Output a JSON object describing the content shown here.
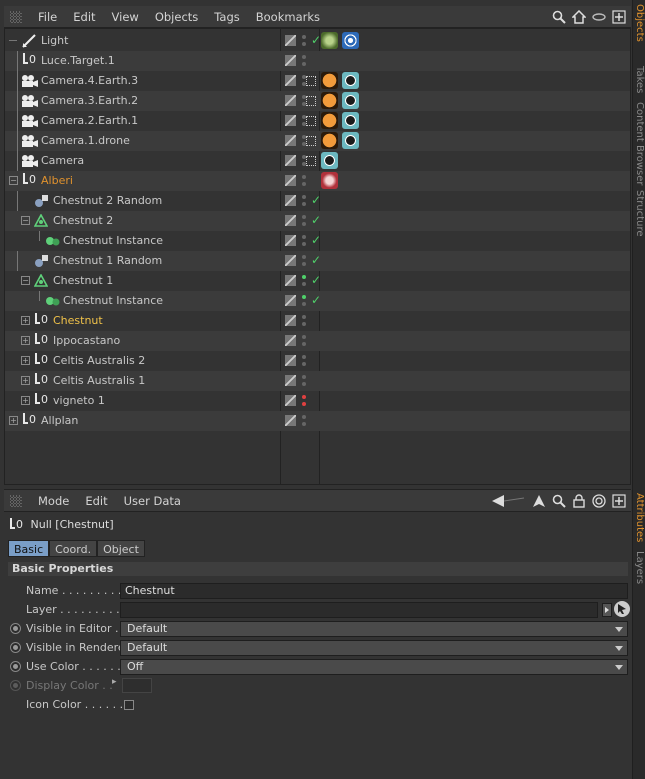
{
  "menubar": {
    "items": [
      "File",
      "Edit",
      "View",
      "Objects",
      "Tags",
      "Bookmarks"
    ]
  },
  "side_tabs": {
    "top": [
      "Objects",
      "Takes",
      "Content Browser",
      "Structure"
    ],
    "bottom": [
      "Attributes",
      "Layers"
    ]
  },
  "tree": {
    "rows": [
      {
        "label": "Light",
        "color": "#c8c8c8"
      },
      {
        "label": "Luce.Target.1",
        "color": "#c8c8c8"
      },
      {
        "label": "Camera.4.Earth.3",
        "color": "#c8c8c8"
      },
      {
        "label": "Camera.3.Earth.2",
        "color": "#c8c8c8"
      },
      {
        "label": "Camera.2.Earth.1",
        "color": "#c8c8c8"
      },
      {
        "label": "Camera.1.drone",
        "color": "#c8c8c8"
      },
      {
        "label": "Camera",
        "color": "#c8c8c8"
      },
      {
        "label": "Alberi",
        "color": "#e0922e"
      },
      {
        "label": "Chestnut 2 Random",
        "color": "#c8c8c8"
      },
      {
        "label": "Chestnut 2",
        "color": "#c8c8c8"
      },
      {
        "label": "Chestnut Instance",
        "color": "#c8c8c8"
      },
      {
        "label": "Chestnut 1 Random",
        "color": "#c8c8c8"
      },
      {
        "label": "Chestnut 1",
        "color": "#c8c8c8"
      },
      {
        "label": "Chestnut Instance",
        "color": "#c8c8c8"
      },
      {
        "label": "Chestnut",
        "color": "#f0c24a"
      },
      {
        "label": "Ippocastano",
        "color": "#c8c8c8"
      },
      {
        "label": "Celtis Australis 2",
        "color": "#c8c8c8"
      },
      {
        "label": "Celtis Australis 1",
        "color": "#c8c8c8"
      },
      {
        "label": "vigneto 1",
        "color": "#c8c8c8"
      },
      {
        "label": "Allplan",
        "color": "#c8c8c8"
      }
    ]
  },
  "attr": {
    "menubar": [
      "Mode",
      "Edit",
      "User Data"
    ],
    "object_title": "Null [Chestnut]",
    "tabs": [
      "Basic",
      "Coord.",
      "Object"
    ],
    "section": "Basic Properties",
    "name_label": "Name . . . . . . . . . .",
    "name_value": "Chestnut",
    "layer_label": "Layer . . . . . . . . .",
    "layer_value": "",
    "vis_editor_label": "Visible in Editor . .",
    "vis_editor_value": "Default",
    "vis_render_label": "Visible in Renderer",
    "vis_render_value": "Default",
    "use_color_label": "Use Color . . . . . .",
    "use_color_value": "Off",
    "display_color_label": "Display Color . .",
    "icon_color_label": "Icon Color . . . . . ."
  }
}
